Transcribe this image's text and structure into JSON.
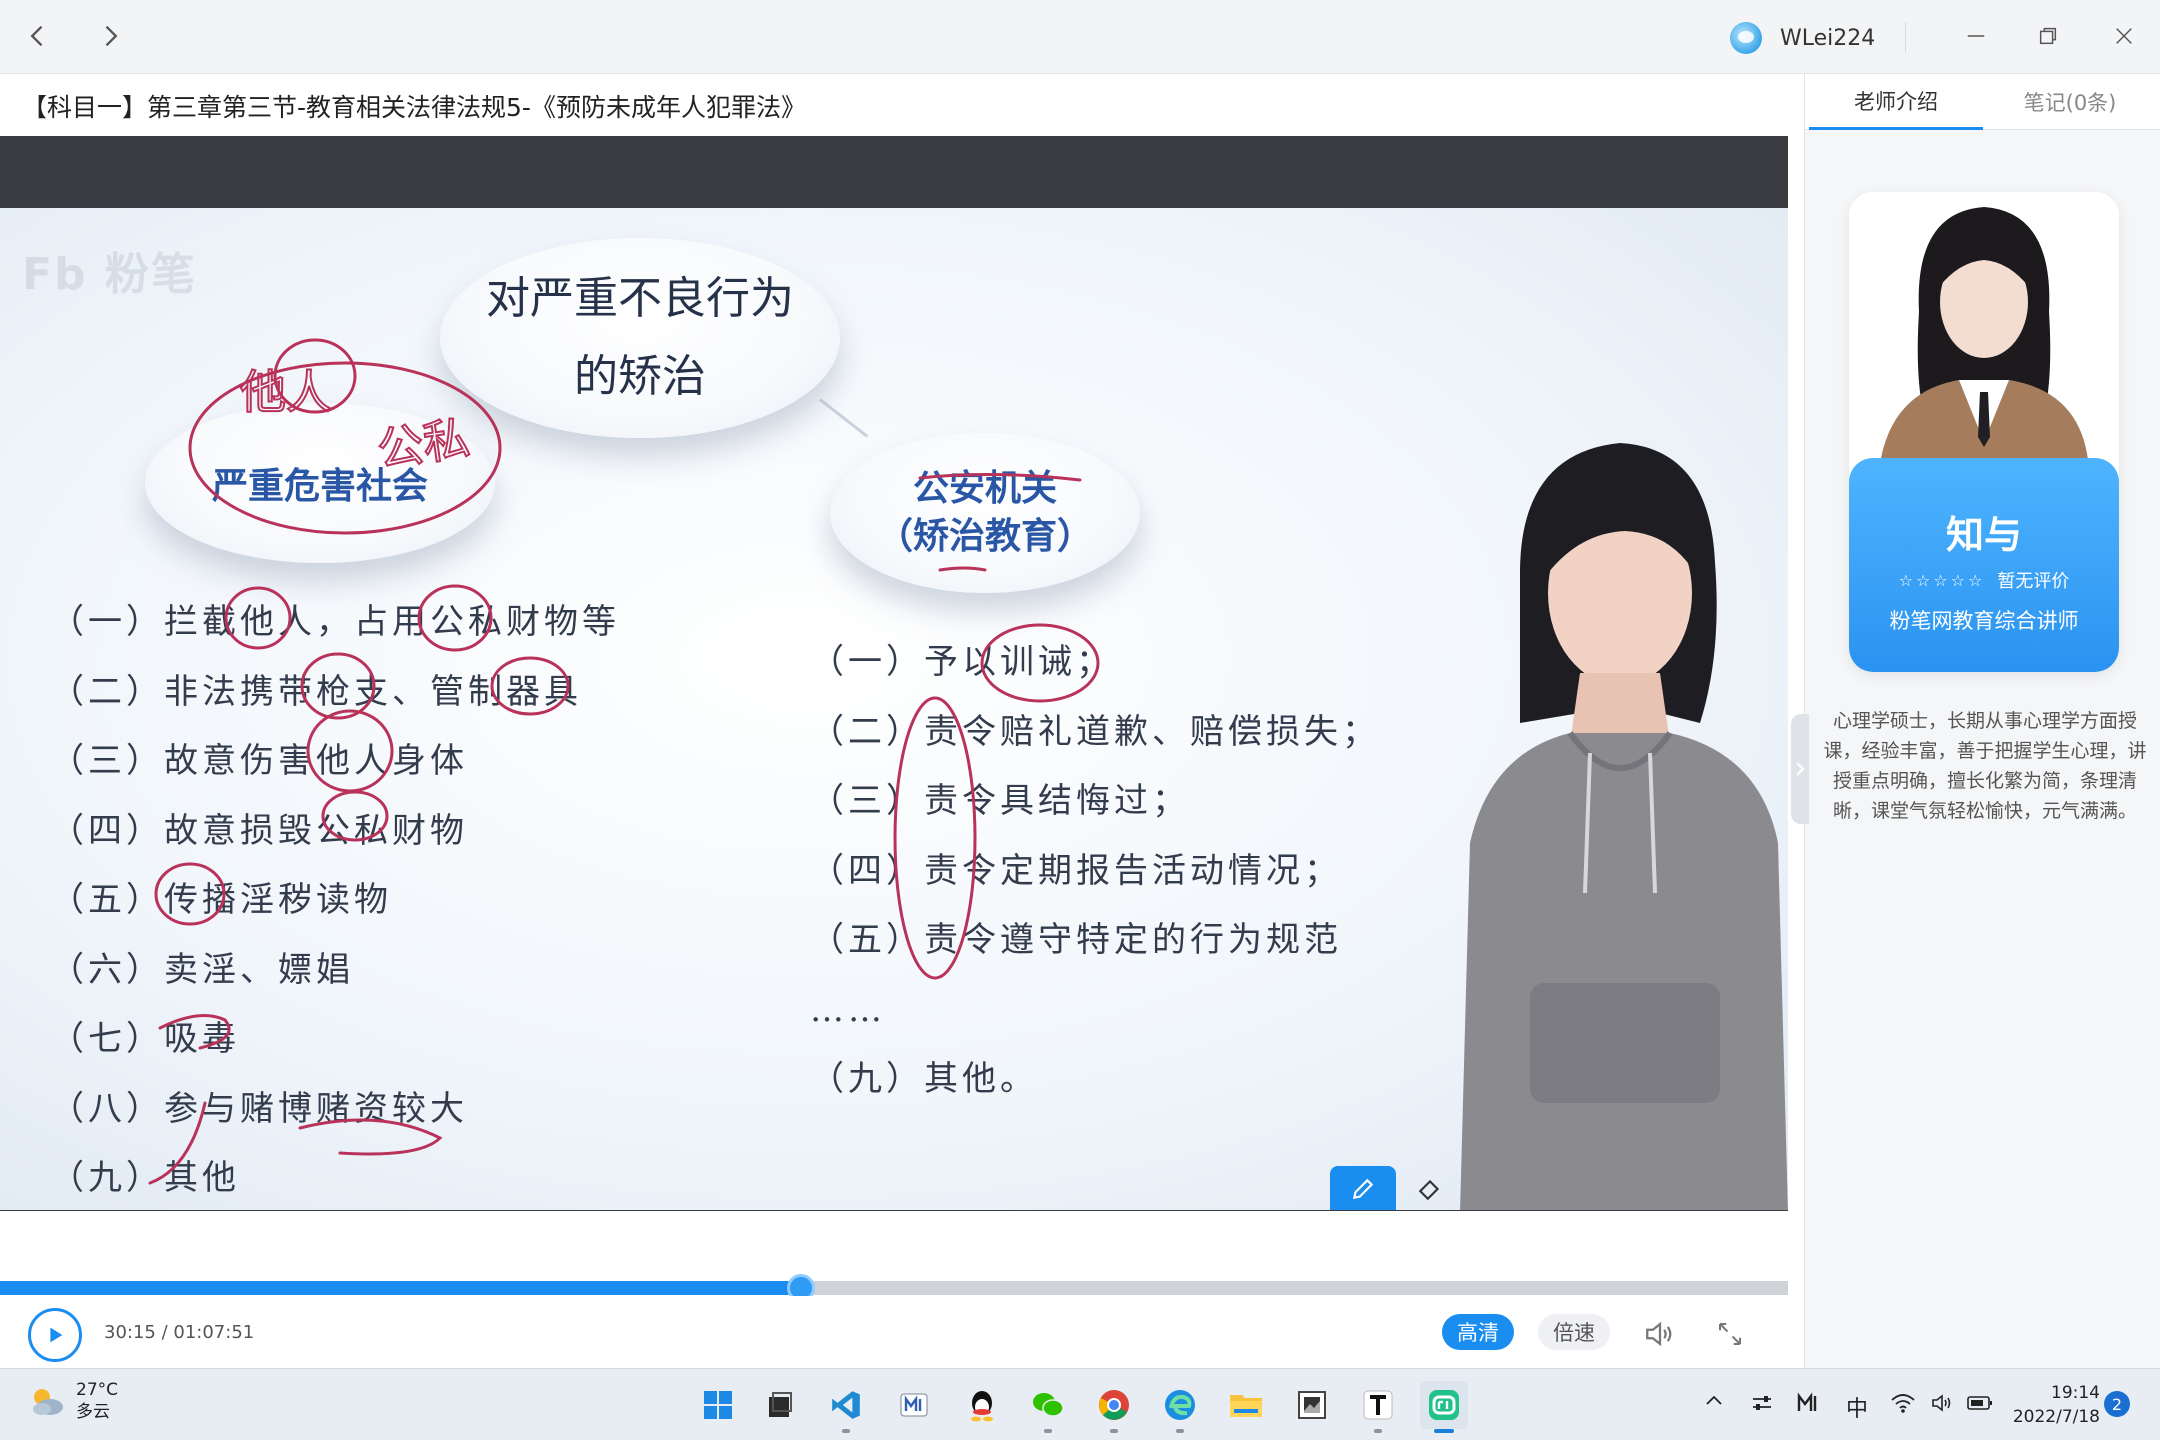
{
  "window": {
    "user_name": "WLei224"
  },
  "course": {
    "title": "【科目一】第三章第三节-教育相关法律法规5-《预防未成年人犯罪法》"
  },
  "slide": {
    "watermark": "Fb 粉笔",
    "main_bubble_line1": "对严重不良行为",
    "main_bubble_line2": "的矫治",
    "left_bubble": "严重危害社会",
    "right_bubble_line1": "公安机关",
    "right_bubble_line2": "（矫治教育）",
    "left_items": [
      "（一）拦截他人，占用公私财物等",
      "（二）非法携带枪支、管制器具",
      "（三）故意伤害他人身体",
      "（四）故意损毁公私财物",
      "（五）传播淫秽读物",
      "（六）卖淫、嫖娼",
      "（七）吸毒",
      "（八）参与赌博赌资较大",
      "（九）其他"
    ],
    "right_items": [
      "（一）予以训诫；",
      "（二）责令赔礼道歉、赔偿损失；",
      "（三）责令具结悔过；",
      "（四）责令定期报告活动情况；",
      "（五）责令遵守特定的行为规范",
      "……",
      "（九）其他。"
    ],
    "annotation_1": "他人",
    "annotation_2": "公私"
  },
  "player": {
    "current_time": "30:15",
    "total_time": "01:07:51",
    "time_separator": " / ",
    "progress": 0.448,
    "hd_label": "高清",
    "speed_label": "倍速",
    "accent_color": "#1a8df0"
  },
  "panel": {
    "tab_teacher": "老师介绍",
    "tab_notes": "笔记(0条)",
    "teacher_name": "知与",
    "stars": "☆☆☆☆☆",
    "rating_text": "暂无评价",
    "teacher_title": "粉笔网教育综合讲师",
    "bio": "心理学硕士，长期从事心理学方面授课，经验丰富，善于把握学生心理，讲授重点明确，擅长化繁为简，条理清晰，课堂气氛轻松愉快，元气满满。"
  },
  "taskbar": {
    "temperature": "27°C",
    "weather": "多云",
    "ime": "中",
    "time": "19:14",
    "date": "2022/7/18",
    "notifications": "2"
  }
}
